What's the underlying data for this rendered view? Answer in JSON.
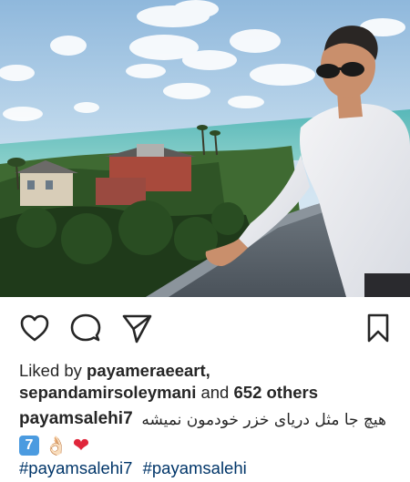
{
  "post": {
    "photo_alt": "man on balcony overlooking sea",
    "actions": {
      "like_icon": "heart-outline-icon",
      "comment_icon": "comment-bubble-icon",
      "share_icon": "paper-plane-icon",
      "save_icon": "bookmark-icon"
    },
    "likes": {
      "prefix": "Liked by",
      "user1": "payameraeeart,",
      "user2": "sepandamirsoleymani",
      "and": "and",
      "others": "652 others"
    },
    "caption": {
      "username": "payamsalehi7",
      "text": "هیچ جا مثل دریای خزر خودمون نمیشه",
      "emoji_keycap": "7",
      "emoji_hand": "👌🏻",
      "emoji_heart": "❤"
    },
    "hashtags": [
      "#payamsalehi7",
      "#payamsalehi"
    ],
    "colors": {
      "text": "#262626",
      "hashtag": "#003569",
      "heart": "#e0263b",
      "keycap": "#4b9be0"
    }
  }
}
